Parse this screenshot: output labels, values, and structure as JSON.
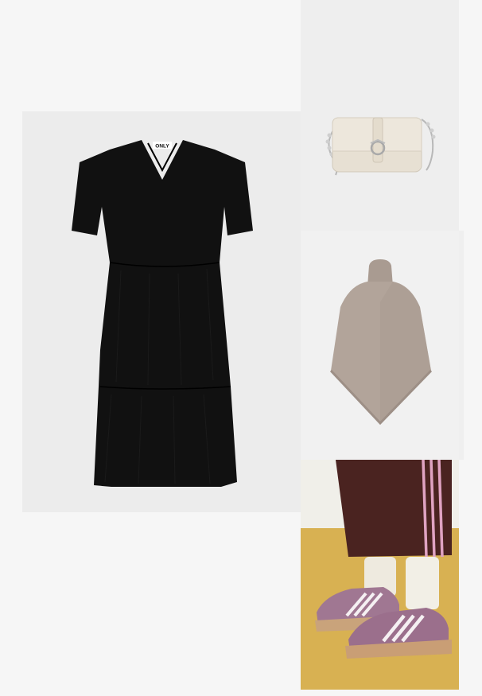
{
  "outfit": {
    "items": [
      {
        "id": "dress",
        "kind": "tiered-dress",
        "brand_label": "ONLY",
        "color": "#0f0f0f"
      },
      {
        "id": "bag",
        "kind": "shoulder-bag",
        "color": "#e7e0d3"
      },
      {
        "id": "poncho",
        "kind": "knit-poncho",
        "color": "#b2a49a"
      },
      {
        "id": "shoes",
        "kind": "sneakers",
        "color": "#a07792"
      }
    ]
  },
  "colors": {
    "page_bg": "#f6f6f6",
    "shoes_bg": "#d8b152"
  }
}
